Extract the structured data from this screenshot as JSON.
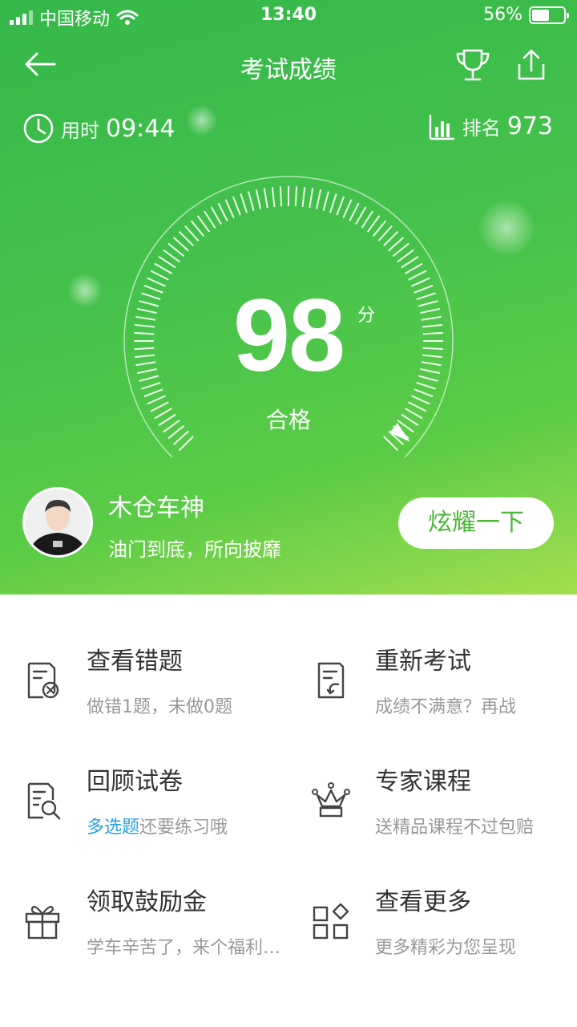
{
  "status_bar": {
    "carrier": "中国移动",
    "time": "13:40",
    "battery": "56%"
  },
  "nav": {
    "title": "考试成绩"
  },
  "meta": {
    "time_label": "用时",
    "time_value": "09:44",
    "rank_label": "排名",
    "rank_value": "973"
  },
  "score": {
    "value": "98",
    "unit": "分",
    "result": "合格"
  },
  "profile": {
    "name": "木仓车神",
    "motto": "油门到底，所向披靡",
    "button": "炫耀一下"
  },
  "options": [
    {
      "title": "查看错题",
      "subtitle": "做错1题，未做0题",
      "icon": "wrong-questions-icon"
    },
    {
      "title": "重新考试",
      "subtitle": "成绩不满意？再战",
      "icon": "retake-icon"
    },
    {
      "title": "回顾试卷",
      "subtitle_highlight": "多选题",
      "subtitle": "还要练习哦",
      "icon": "review-paper-icon"
    },
    {
      "title": "专家课程",
      "subtitle": "送精品课程不过包赔",
      "icon": "crown-icon"
    },
    {
      "title": "领取鼓励金",
      "subtitle": "学车辛苦了，来个福利…",
      "icon": "gift-icon"
    },
    {
      "title": "查看更多",
      "subtitle": "更多精彩为您呈现",
      "icon": "more-grid-icon"
    }
  ],
  "colors": {
    "hero_green": "#45c24b",
    "button_text": "#4cb838",
    "highlight_blue": "#2ba0e0"
  }
}
